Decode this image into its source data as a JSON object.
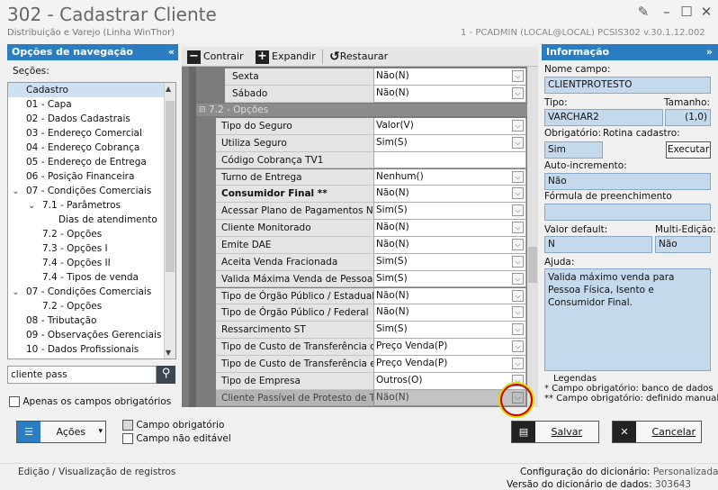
{
  "window": {
    "title": "302 - Cadastrar Cliente",
    "subtitle": "Distribuição e Varejo (Linha WinThor)",
    "session": "1 - PCADMIN (LOCAL@LOCAL)   PCSIS302   v.30.1.12.002",
    "controls": [
      "✎",
      "–",
      "☐",
      "✕"
    ]
  },
  "nav": {
    "header": "Opções de navegação",
    "sections_label": "Seções:",
    "tree": [
      {
        "label": "Cadastro",
        "indent": 0,
        "expander": ""
      },
      {
        "label": "01 - Capa",
        "indent": 0,
        "expander": ""
      },
      {
        "label": "02 - Dados Cadastrais",
        "indent": 0,
        "expander": ""
      },
      {
        "label": "03 - Endereço Comercial",
        "indent": 0,
        "expander": ""
      },
      {
        "label": "04 - Endereço Cobrança",
        "indent": 0,
        "expander": ""
      },
      {
        "label": "05 - Endereço de Entrega",
        "indent": 0,
        "expander": ""
      },
      {
        "label": "06 - Posição Financeira",
        "indent": 0,
        "expander": ""
      },
      {
        "label": "07 - Condições Comerciais",
        "indent": 0,
        "expander": "⌄"
      },
      {
        "label": "7.1 - Parâmetros",
        "indent": 1,
        "expander": "⌄"
      },
      {
        "label": "Dias de atendimento",
        "indent": 2,
        "expander": ""
      },
      {
        "label": "7.2 - Opções",
        "indent": 1,
        "expander": ""
      },
      {
        "label": "7.3 - Opções I",
        "indent": 1,
        "expander": ""
      },
      {
        "label": "7.4 - Opções II",
        "indent": 1,
        "expander": ""
      },
      {
        "label": "7.4 - Tipos de venda",
        "indent": 1,
        "expander": ""
      },
      {
        "label": "07 - Condições Comerciais",
        "indent": 0,
        "expander": "⌄"
      },
      {
        "label": "7.2 - Opções",
        "indent": 1,
        "expander": ""
      },
      {
        "label": "08 - Tributação",
        "indent": 0,
        "expander": ""
      },
      {
        "label": "09 - Observações Gerenciais",
        "indent": 0,
        "expander": ""
      },
      {
        "label": "10 - Dados Profissionais",
        "indent": 0,
        "expander": ""
      }
    ],
    "search_value": "cliente pass",
    "only_required_label": "Apenas os campos obrigatórios"
  },
  "toolbar": {
    "collapse": "Contrair",
    "expand": "Expandir",
    "restore": "Restaurar"
  },
  "grid": {
    "top_rows": [
      {
        "label": "Sexta",
        "value": "Não(N)"
      },
      {
        "label": "Sábado",
        "value": "Não(N)"
      }
    ],
    "section_title": "7.2 - Opções",
    "rows": [
      {
        "label": "Tipo do Seguro",
        "value": "Valor(V)",
        "dropdown": true,
        "bold": false
      },
      {
        "label": "Utiliza Seguro",
        "value": "Sim(S)",
        "dropdown": true,
        "bold": false
      },
      {
        "label": "Código Cobrança TV1",
        "value": "",
        "dropdown": false,
        "bold": false
      },
      {
        "label": "Turno de Entrega",
        "value": "Nenhum()",
        "dropdown": true,
        "bold": false
      },
      {
        "label": "Consumidor Final **",
        "value": "Não(N)",
        "dropdown": true,
        "bold": true
      },
      {
        "label": "Acessar Plano de Pagamentos Negociados",
        "value": "Sim(S)",
        "dropdown": true,
        "bold": false
      },
      {
        "label": "Cliente Monitorado",
        "value": "Não(N)",
        "dropdown": true,
        "bold": false
      },
      {
        "label": "Emite DAE",
        "value": "Não(N)",
        "dropdown": true,
        "bold": false
      },
      {
        "label": "Aceita Venda Fracionada",
        "value": "Sim(S)",
        "dropdown": true,
        "bold": false
      },
      {
        "label": "Valida Máxima Venda de Pessoa Física",
        "value": "Sim(S)",
        "dropdown": true,
        "bold": false
      },
      {
        "label": "Tipo de Órgão Público / Estadual",
        "value": "Não(N)",
        "dropdown": true,
        "bold": false
      },
      {
        "label": "Tipo de Órgão Público / Federal",
        "value": "Não(N)",
        "dropdown": true,
        "bold": false
      },
      {
        "label": "Ressarcimento ST",
        "value": "Sim(S)",
        "dropdown": true,
        "bold": false
      },
      {
        "label": "Tipo de Custo de Transferência de",
        "value": "Preço Venda(P)",
        "dropdown": true,
        "bold": false
      },
      {
        "label": "Tipo de Custo de Transferência en",
        "value": "Preço Venda(P)",
        "dropdown": true,
        "bold": false
      },
      {
        "label": "Tipo de Empresa",
        "value": "Outros(O)",
        "dropdown": true,
        "bold": false
      },
      {
        "label": "Cliente Passível de Protesto de Títulos",
        "value": "Não(N)",
        "dropdown": true,
        "bold": false
      }
    ]
  },
  "info": {
    "header": "Informação",
    "field_name_label": "Nome campo:",
    "field_name": "CLIENTPROTESTO",
    "type_label": "Tipo:",
    "size_label": "Tamanho:",
    "type": "VARCHAR2",
    "size": "(1,0)",
    "required_label": "Obrigatório:",
    "routine_label": "Rotina cadastro:",
    "required": "Sim",
    "run_button": "Executar",
    "autoinc_label": "Auto-incremento:",
    "autoinc": "Não",
    "formula_label": "Fórmula de preenchimento",
    "formula": "",
    "default_label": "Valor default:",
    "multi_label": "Multi-Edição:",
    "default": "N",
    "multi": "Não",
    "help_label": "Ajuda:",
    "help": "Valida máximo venda para Pessoa Física, Isento e Consumidor Final.",
    "legend_title": "Legendas",
    "legend_1": "* Campo obrigatório: banco de dados",
    "legend_2": "** Campo obrigatório: definido manual"
  },
  "bottom": {
    "actions": "Ações",
    "required_field": "Campo obrigatório",
    "not_editable": "Campo não editável",
    "save": "Salvar",
    "cancel": "Cancelar"
  },
  "status": {
    "mode": "Edição / Visualização de registros",
    "dict_config_label": "Configuração do dicionário:",
    "dict_config": "Personalizada",
    "dict_version_label": "Versão do dicionário de dados:",
    "dict_version": "303643"
  },
  "colors": {
    "accent": "#2b7dc2",
    "info_box": "#c5d9ec",
    "highlight": "#d9d900"
  }
}
